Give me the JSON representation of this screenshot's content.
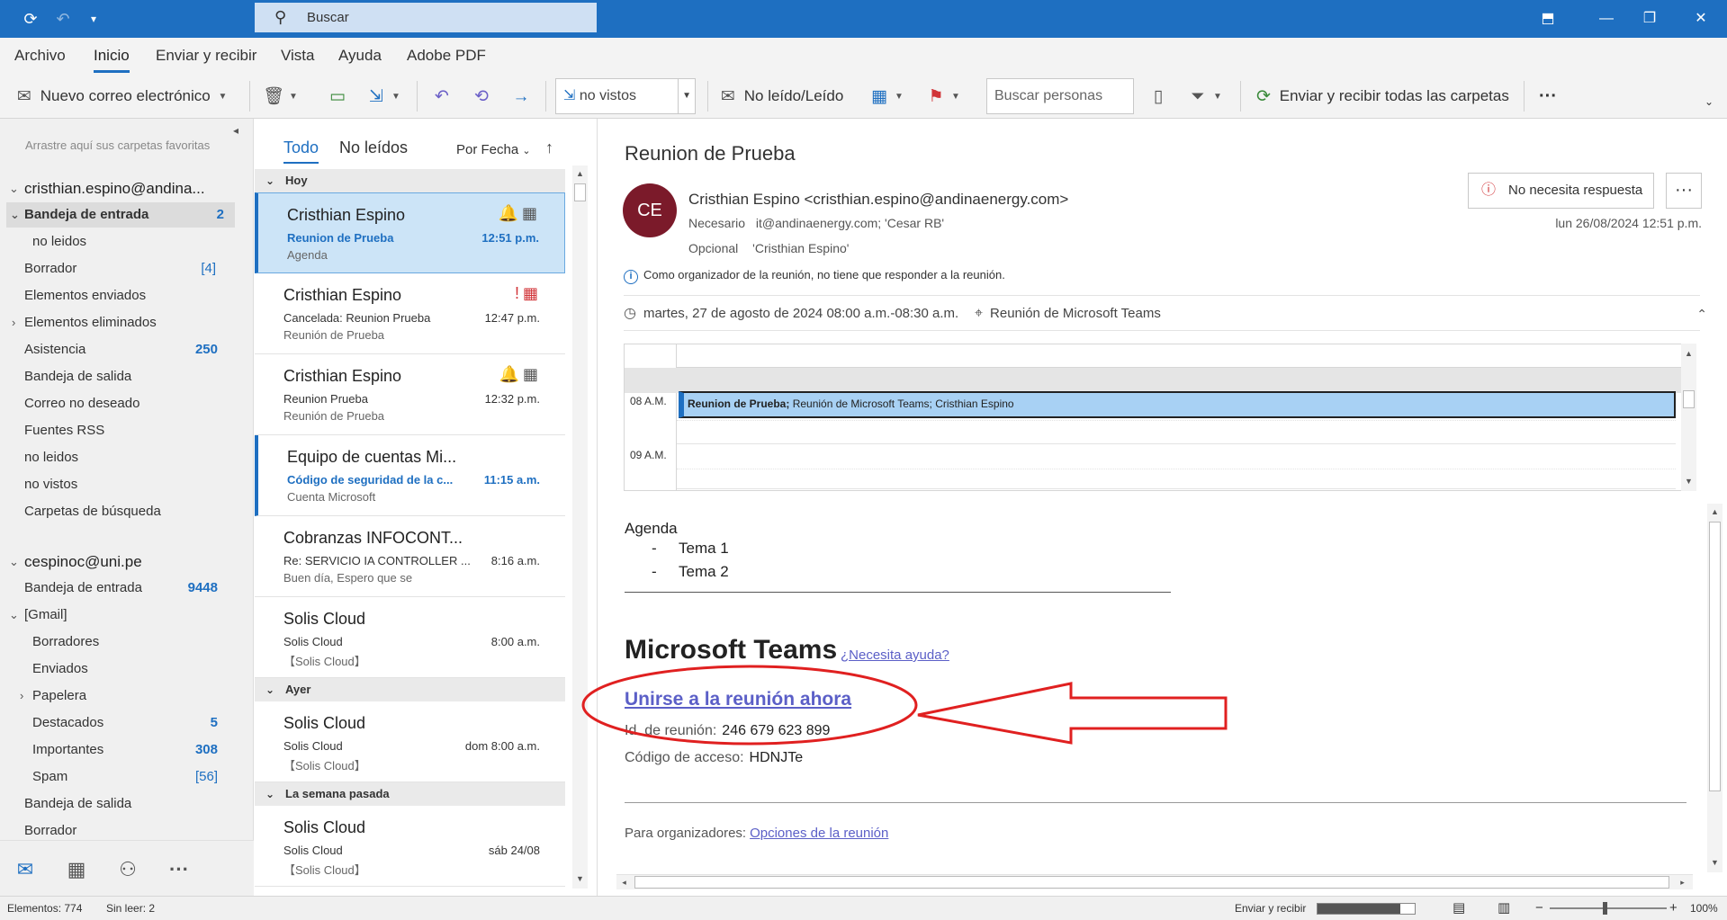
{
  "titlebar": {
    "search_placeholder": "Buscar",
    "icons": [
      "refresh-icon",
      "undo-icon",
      "customize-dropdown-icon",
      "ribbon-display-icon",
      "restore-icon",
      "close-icon"
    ]
  },
  "menu": {
    "items": [
      "Archivo",
      "Inicio",
      "Enviar y recibir",
      "Vista",
      "Ayuda",
      "Adobe PDF"
    ],
    "active": "Inicio"
  },
  "ribbon": {
    "new_mail": "Nuevo correo electrónico",
    "filter_value": "no vistos",
    "read_unread": "No leído/Leído",
    "search_people_placeholder": "Buscar personas",
    "send_receive_all": "Enviar y recibir todas las carpetas",
    "more": "···"
  },
  "folders": {
    "favorites_hint": "Arrastre aquí sus carpetas favoritas",
    "account1": {
      "name": "cristhian.espino@andina...",
      "items": [
        {
          "label": "Bandeja de entrada",
          "count": "2"
        },
        {
          "label": "no leidos",
          "count": ""
        },
        {
          "label": "Borrador",
          "count": "[4]"
        },
        {
          "label": "Elementos enviados",
          "count": ""
        },
        {
          "label": "Elementos eliminados",
          "count": ""
        },
        {
          "label": "Asistencia",
          "count": "250"
        },
        {
          "label": "Bandeja de salida",
          "count": ""
        },
        {
          "label": "Correo no deseado",
          "count": ""
        },
        {
          "label": "Fuentes RSS",
          "count": ""
        },
        {
          "label": "no leidos",
          "count": ""
        },
        {
          "label": "no vistos",
          "count": ""
        },
        {
          "label": "Carpetas de búsqueda",
          "count": ""
        }
      ]
    },
    "account2": {
      "name": "cespinoc@uni.pe",
      "items": [
        {
          "label": "Bandeja de entrada",
          "count": "9448"
        },
        {
          "label": "[Gmail]",
          "count": ""
        },
        {
          "label": "Borradores",
          "count": ""
        },
        {
          "label": "Enviados",
          "count": ""
        },
        {
          "label": "Papelera",
          "count": ""
        },
        {
          "label": "Destacados",
          "count": "5"
        },
        {
          "label": "Importantes",
          "count": "308"
        },
        {
          "label": "Spam",
          "count": "[56]"
        },
        {
          "label": "Bandeja de salida",
          "count": ""
        },
        {
          "label": "Borrador",
          "count": ""
        }
      ]
    },
    "nav_icons": [
      "mail-icon",
      "calendar-icon",
      "people-icon",
      "more-icon"
    ]
  },
  "message_list": {
    "tabs": [
      "Todo",
      "No leídos"
    ],
    "sort_label": "Por Fecha",
    "groups": [
      "Hoy",
      "Ayer",
      "La semana pasada"
    ],
    "messages": [
      {
        "from": "Cristhian Espino",
        "subject": "Reunion de Prueba",
        "preview": "Agenda",
        "time": "12:51 p.m."
      },
      {
        "from": "Cristhian Espino",
        "subject": "Cancelada: Reunion Prueba",
        "preview": "Reunión de Prueba",
        "time": "12:47 p.m."
      },
      {
        "from": "Cristhian Espino",
        "subject": "Reunion Prueba",
        "preview": "Reunión de Prueba",
        "time": "12:32 p.m."
      },
      {
        "from": "Equipo de cuentas Mi...",
        "subject": "Código de seguridad de la c...",
        "preview": "Cuenta Microsoft",
        "time": "11:15 a.m."
      },
      {
        "from": "Cobranzas INFOCONT...",
        "subject": "Re: SERVICIO IA CONTROLLER ...",
        "preview": "Buen día,  Espero que se",
        "time": "8:16 a.m."
      },
      {
        "from": "Solis Cloud",
        "subject": "Solis Cloud",
        "preview": "【Solis Cloud】",
        "time": "8:00 a.m."
      },
      {
        "from": "Solis Cloud",
        "subject": "Solis Cloud",
        "preview": "【Solis Cloud】",
        "time": "dom 8:00 a.m."
      },
      {
        "from": "Solis Cloud",
        "subject": "Solis Cloud",
        "preview": "【Solis Cloud】",
        "time": "sáb 24/08"
      }
    ]
  },
  "reading": {
    "subject": "Reunion de Prueba",
    "no_response_btn": "No necesita respuesta",
    "avatar_initials": "CE",
    "sender": "Cristhian Espino <cristhian.espino@andinaenergy.com>",
    "required_label": "Necesario",
    "required_value": "it@andinaenergy.com; 'Cesar RB'",
    "optional_label": "Opcional",
    "optional_value": "'Cristhian Espino'",
    "date": "lun 26/08/2024 12:51 p.m.",
    "info": "Como organizador de la reunión, no tiene que responder a la reunión.",
    "when": "martes, 27 de agosto de 2024 08:00 a.m.-08:30 a.m.",
    "where": "Reunión de Microsoft Teams",
    "calendar": {
      "hours": [
        "08 A.M.",
        "09 A.M."
      ],
      "event_title": "Reunion de Prueba;",
      "event_detail": "Reunión de Microsoft Teams; Cristhian Espino"
    },
    "body": {
      "agenda_title": "Agenda",
      "agenda_items": [
        "Tema 1",
        "Tema 2"
      ],
      "teams_title": "Microsoft Teams",
      "help_link": "¿Necesita ayuda?",
      "join_link": "Unirse a la reunión ahora",
      "meeting_id_label": "Id. de reunión:",
      "meeting_id": "246 679 623 899",
      "access_label": "Código de acceso:",
      "access_code": "HDNJTe",
      "organizers_label": "Para organizadores:",
      "organizers_link": "Opciones de la reunión"
    }
  },
  "status": {
    "items": "Elementos: 774",
    "unread": "Sin leer: 2",
    "send_receive": "Enviar y recibir",
    "progress": 0.85,
    "zoom": "100%"
  },
  "colors": {
    "accent": "#1e6fc1",
    "annotation": "#e02020",
    "link": "#5b5fc7",
    "avatar": "#7b1a2a"
  }
}
